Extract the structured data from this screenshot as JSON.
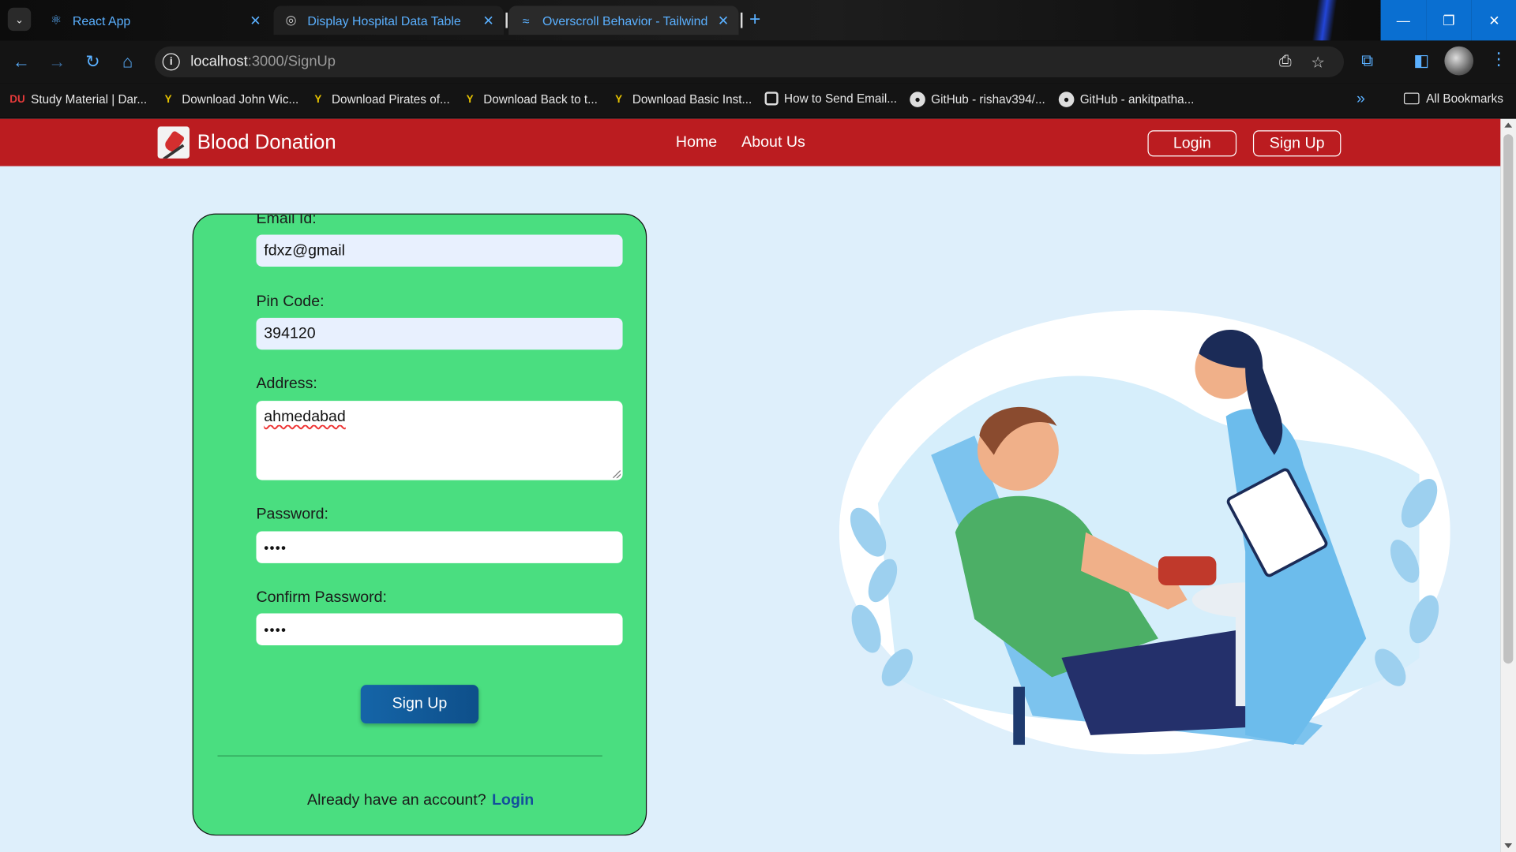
{
  "browser": {
    "tabs": [
      {
        "title": "React App",
        "icon": "react-icon"
      },
      {
        "title": "Display Hospital Data Table",
        "icon": "chatgpt-icon"
      },
      {
        "title": "Overscroll Behavior - Tailwind C",
        "icon": "tailwind-icon"
      }
    ],
    "url_host": "localhost",
    "url_path": ":3000/SignUp",
    "bookmarks": [
      "Study Material | Dar...",
      "Download John Wic...",
      "Download Pirates of...",
      "Download Back to t...",
      "Download Basic Inst...",
      "How to Send Email...",
      "GitHub - rishav394/...",
      "GitHub - ankitpatha..."
    ],
    "all_bookmarks": "All Bookmarks",
    "accent": "#5ab0ff"
  },
  "navbar": {
    "brand": "Blood Donation",
    "links": [
      "Home",
      "About Us"
    ],
    "login": "Login",
    "signup": "Sign Up",
    "color": "#bb1c20"
  },
  "form": {
    "email_label": "Email Id:",
    "email_value": "fdxz@gmail",
    "pin_label": "Pin Code:",
    "pin_value": "394120",
    "address_label": "Address:",
    "address_value": "ahmedabad",
    "password_label": "Password:",
    "password_value": "••••",
    "confirm_label": "Confirm Password:",
    "confirm_value": "••••",
    "submit": "Sign Up",
    "already_text": "Already have an account?",
    "login_link": "Login",
    "card_color": "#4ade80"
  },
  "illustration": {
    "subject": "blood-donation-illustration"
  }
}
